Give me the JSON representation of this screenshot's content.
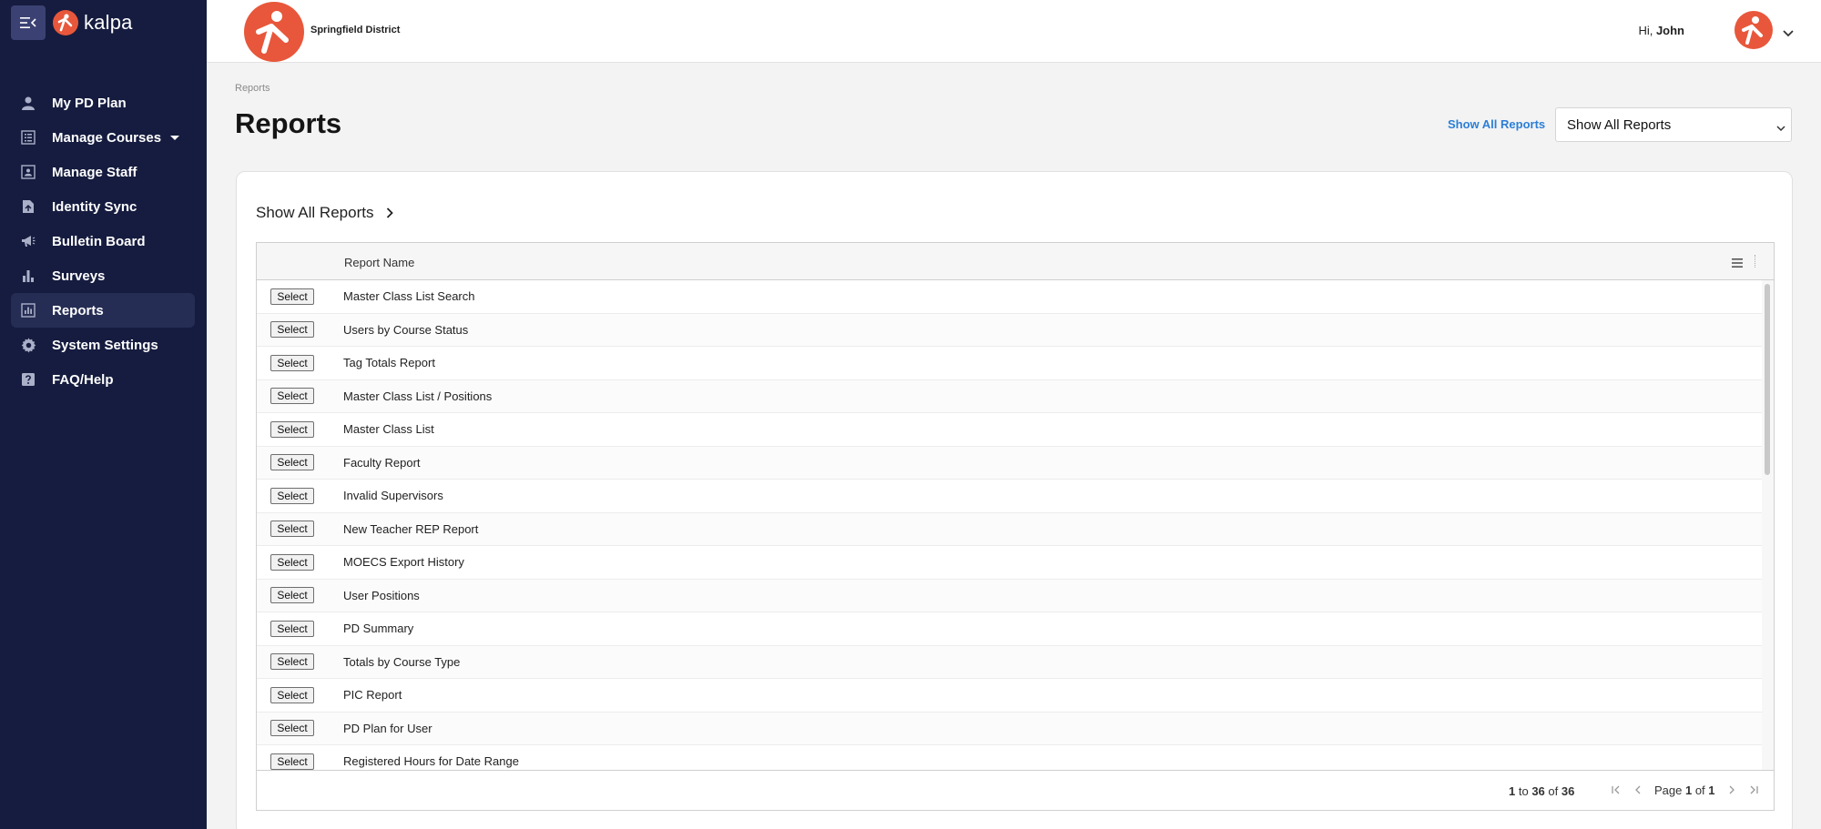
{
  "app": {
    "brand": "kalpa"
  },
  "colors": {
    "sidebar": "#161c3f",
    "accent": "#e8573b",
    "link": "#2b7fd6"
  },
  "sidebar": {
    "items": [
      {
        "label": "My PD Plan",
        "icon": "person-icon"
      },
      {
        "label": "Manage Courses",
        "icon": "list-icon"
      },
      {
        "label": "Manage Staff",
        "icon": "staff-card-icon"
      },
      {
        "label": "Identity Sync",
        "icon": "file-sync-icon"
      },
      {
        "label": "Bulletin Board",
        "icon": "megaphone-icon"
      },
      {
        "label": "Surveys",
        "icon": "bar-chart-icon"
      },
      {
        "label": "Reports",
        "icon": "report-chart-icon"
      },
      {
        "label": "System Settings",
        "icon": "gear-icon"
      },
      {
        "label": "FAQ/Help",
        "icon": "help-icon"
      }
    ]
  },
  "header": {
    "district": "Springfield District",
    "greeting_prefix": "Hi, ",
    "user_name": "John"
  },
  "main": {
    "breadcrumb": "Reports",
    "title": "Reports",
    "show_all_link": "Show All Reports",
    "filter_selected": "Show All Reports",
    "card_heading": "Show All Reports"
  },
  "grid": {
    "column_header": "Report Name",
    "select_label": "Select",
    "rows": [
      "Master Class List Search",
      "Users by Course Status",
      "Tag Totals Report",
      "Master Class List / Positions",
      "Master Class List",
      "Faculty Report",
      "Invalid Supervisors",
      "New Teacher REP Report",
      "MOECS Export History",
      "User Positions",
      "PD Summary",
      "Totals by Course Type",
      "PIC Report",
      "PD Plan for User",
      "Registered Hours for Date Range"
    ],
    "footer": {
      "range_start": "1",
      "to": " to ",
      "range_end": "36",
      "of": " of ",
      "total": "36",
      "page_prefix": "Page ",
      "page_current": "1",
      "page_of": " of ",
      "page_total": "1"
    }
  }
}
